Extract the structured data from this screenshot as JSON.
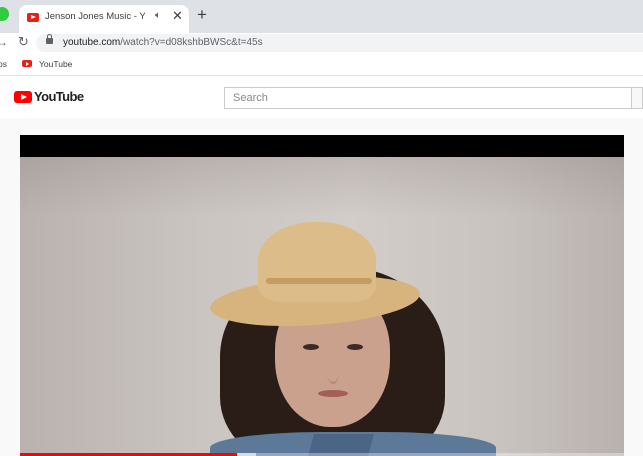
{
  "browser": {
    "tab": {
      "title": "Jenson Jones Music - YouTube",
      "audio_icon": "speaker-icon",
      "close_glyph": "✕"
    },
    "new_tab_glyph": "+",
    "reload_glyph": "↻",
    "back_glyph": "→",
    "url_domain": "youtube.com",
    "url_path": "/watch?v=d08kshbBWSc&t=45s",
    "bookmarks": {
      "apps_label": "ps",
      "youtube_label": "YouTube"
    }
  },
  "youtube": {
    "logo_text": "YouTube",
    "search_placeholder": "Search",
    "player": {
      "progress_fraction": 0.36,
      "loaded_fraction": 0.39
    }
  },
  "colors": {
    "brand_red": "#ff0000",
    "tab_strip": "#dee1e6"
  }
}
